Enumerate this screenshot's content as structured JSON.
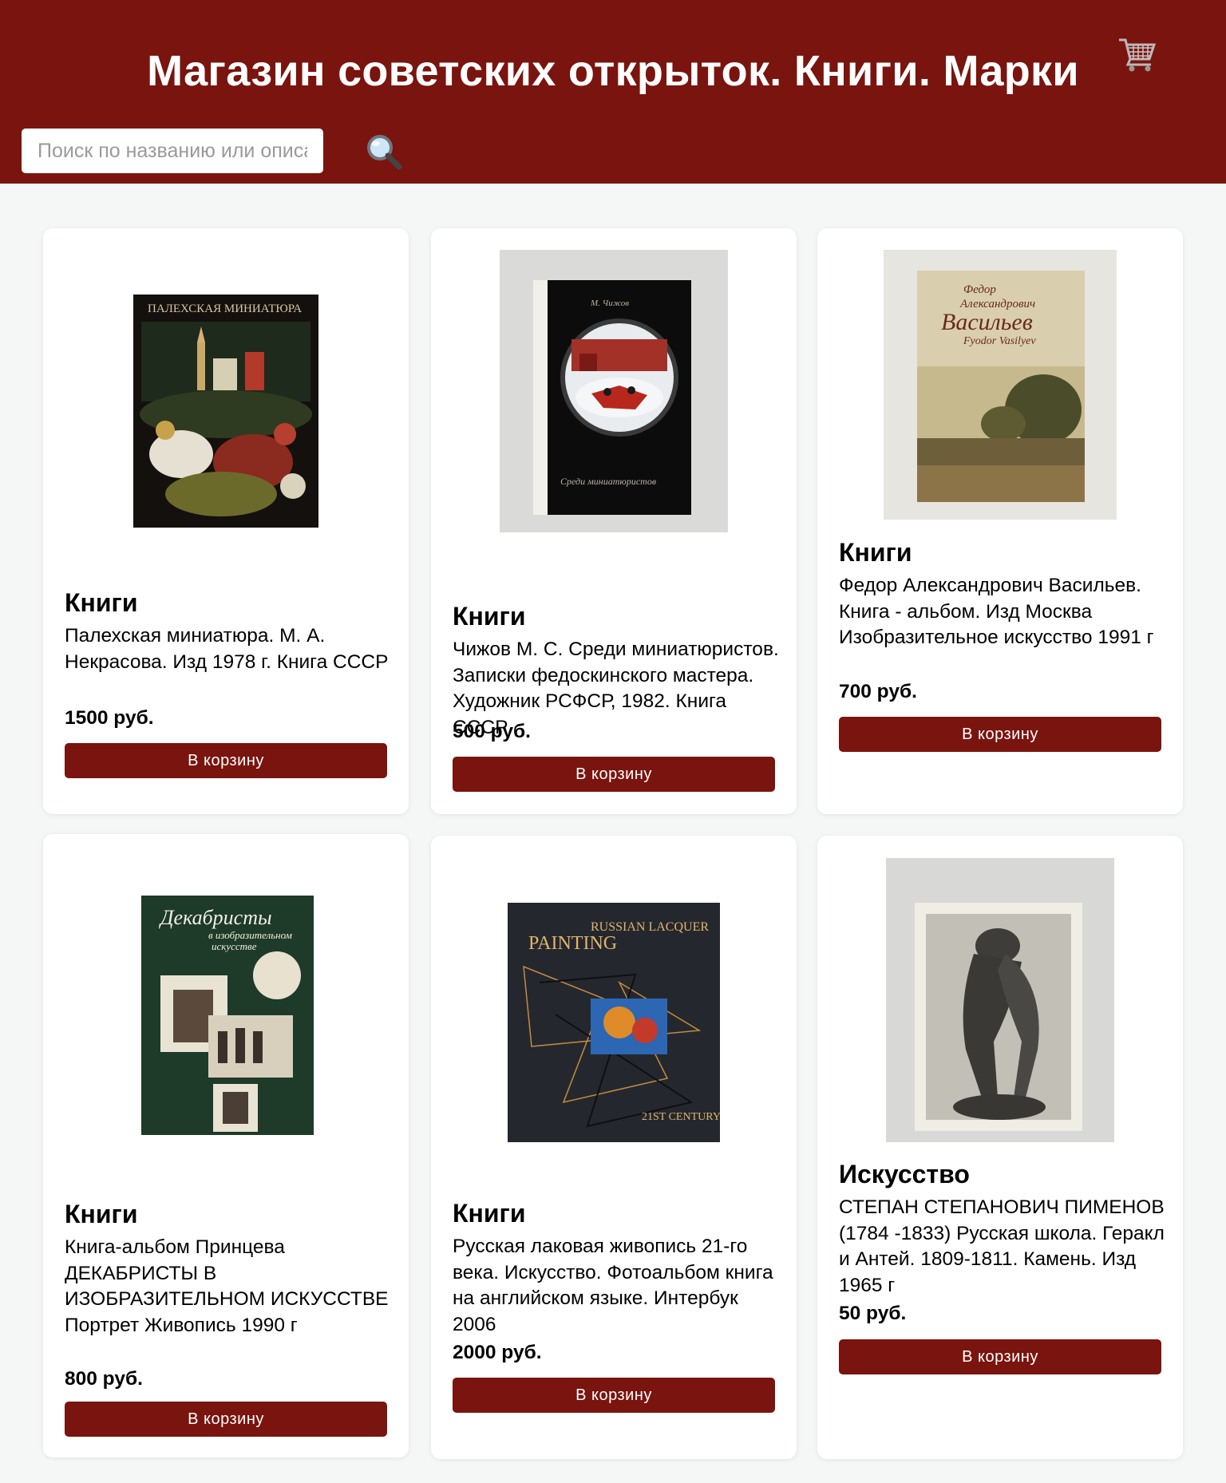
{
  "header": {
    "title": "Магазин советских открыток. Книги. Марки",
    "cart_icon": "shopping-cart-icon",
    "search_placeholder": "Поиск по названию или описанию",
    "search_icon": "magnifier-icon"
  },
  "colors": {
    "brand": "#7a140e",
    "page_background": "#f5f6f6",
    "card_background": "#ffffff"
  },
  "products": [
    {
      "category": "Книги",
      "description": "Палехская миниатюра. М. А. Некрасова. Изд 1978 г. Книга СССР",
      "price": "1500 руб.",
      "button": "В корзину",
      "cover_text": [
        "ПАЛЕХСКАЯ МИНИАТЮРА"
      ]
    },
    {
      "category": "Книги",
      "description": "Чижов М. С. Среди миниатюристов. Записки федоскинского мастера. Художник РСФСР, 1982. Книга СССР",
      "price": "500 руб.",
      "button": "В корзину",
      "cover_text": [
        "М. Чижов",
        "Среди миниатюристов"
      ]
    },
    {
      "category": "Книги",
      "description": "Федор Александрович Васильев. Книга - альбом. Изд Москва Изобразительное искусство 1991 г",
      "price": "700 руб.",
      "button": "В корзину",
      "cover_text": [
        "Федор",
        "Александрович",
        "Васильев",
        "Fyodor Vasilyev"
      ]
    },
    {
      "category": "Книги",
      "description": "Книга-альбом Принцева ДЕКАБРИСТЫ В ИЗОБРАЗИТЕЛЬНОМ ИСКУССТВЕ Портрет Живопись 1990 г",
      "price": "800 руб.",
      "button": "В корзину",
      "cover_text": [
        "Декабристы",
        "в изобразительном",
        "искусстве"
      ]
    },
    {
      "category": "Книги",
      "description": "Русская лаковая живопись 21-го века. Искусство. Фотоальбом книга на английском языке. Интербук 2006",
      "price": "2000 руб.",
      "button": "В корзину",
      "cover_text": [
        "RUSSIAN LACQUER",
        "PAINTING",
        "21ST CENTURY"
      ]
    },
    {
      "category": "Искусство",
      "description": "СТЕПАН СТЕПАНОВИЧ ПИМЕНОВ (1784 -1833) Русская школа. Геракл и Антей. 1809-1811. Камень. Изд 1965 г",
      "price": "50 руб.",
      "button": "В корзину",
      "cover_text": []
    }
  ]
}
